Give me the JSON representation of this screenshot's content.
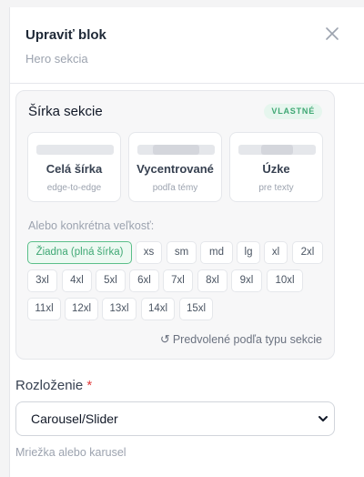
{
  "panel": {
    "title": "Upraviť blok",
    "subtitle": "Hero sekcia",
    "close_icon": "close-icon"
  },
  "width_section": {
    "title": "Šírka sekcie",
    "badge": "VLASTNÉ",
    "options": [
      {
        "name": "Celá šírka",
        "hint": "edge-to-edge"
      },
      {
        "name": "Vycentrované",
        "hint": "podľa témy"
      },
      {
        "name": "Úzke",
        "hint": "pre texty"
      }
    ],
    "size_label": "Alebo konkrétna veľkosť:",
    "sizes": [
      "Žiadna (plná šírka)",
      "xs",
      "sm",
      "md",
      "lg",
      "xl",
      "2xl",
      "3xl",
      "4xl",
      "5xl",
      "6xl",
      "7xl",
      "8xl",
      "9xl",
      "10xl",
      "11xl",
      "12xl",
      "13xl",
      "14xl",
      "15xl"
    ],
    "selected_size": "Žiadna (plná šírka)",
    "reset_label": "Predvolené podľa typu sekcie",
    "reset_icon": "rotate-ccw-icon"
  },
  "layout": {
    "label": "Rozloženie",
    "required_mark": "*",
    "value": "Carousel/Slider",
    "help": "Mriežka alebo karusel",
    "chevron_icon": "chevron-down-icon"
  },
  "colors": {
    "accent": "#3fa874",
    "accent_bg": "#edf9f2",
    "required": "#e23b3b"
  }
}
